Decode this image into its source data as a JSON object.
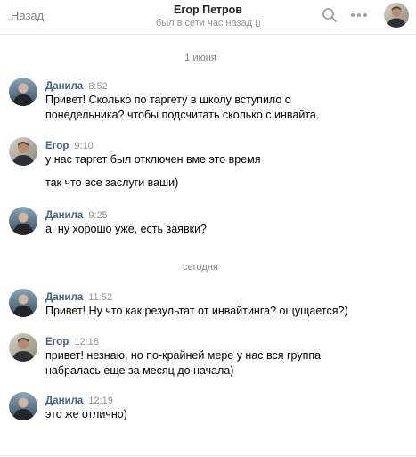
{
  "header": {
    "back_label": "Назад",
    "title": "Егор Петров",
    "status": "был в сети час назад",
    "icons": [
      "search-icon",
      "more-icon",
      "phone-icon"
    ]
  },
  "separators": {
    "first": "1 июня",
    "second": "сегодня"
  },
  "messages": [
    {
      "name": "Данила",
      "time": "8:52",
      "lines": [
        "Привет! Сколько по таргету в школу вступило с",
        "понедельника? чтобы подсчитать сколько с инвайта"
      ]
    },
    {
      "name": "Егор",
      "time": "9:10",
      "lines": [
        "у нас таргет был отключен вме это время",
        "так что все заслуги ваши)"
      ]
    },
    {
      "name": "Данила",
      "time": "9:25",
      "lines": [
        "а, ну хорошо уже, есть заявки?"
      ]
    },
    {
      "name": "Данила",
      "time": "11:52",
      "lines": [
        "Привет! Ну что как результат от инвайтинга? ощущается?)"
      ]
    },
    {
      "name": "Егор",
      "time": "12:18",
      "lines": [
        "привет! незнаю, но по-крайней мере у нас вся группа",
        "набралась еще за месяц до начала)"
      ]
    },
    {
      "name": "Данила",
      "time": "12:19",
      "lines": [
        "это же отлично)"
      ]
    }
  ],
  "colors": {
    "name": "#42648b",
    "muted": "#939393",
    "divider": "#e7e8ec"
  }
}
